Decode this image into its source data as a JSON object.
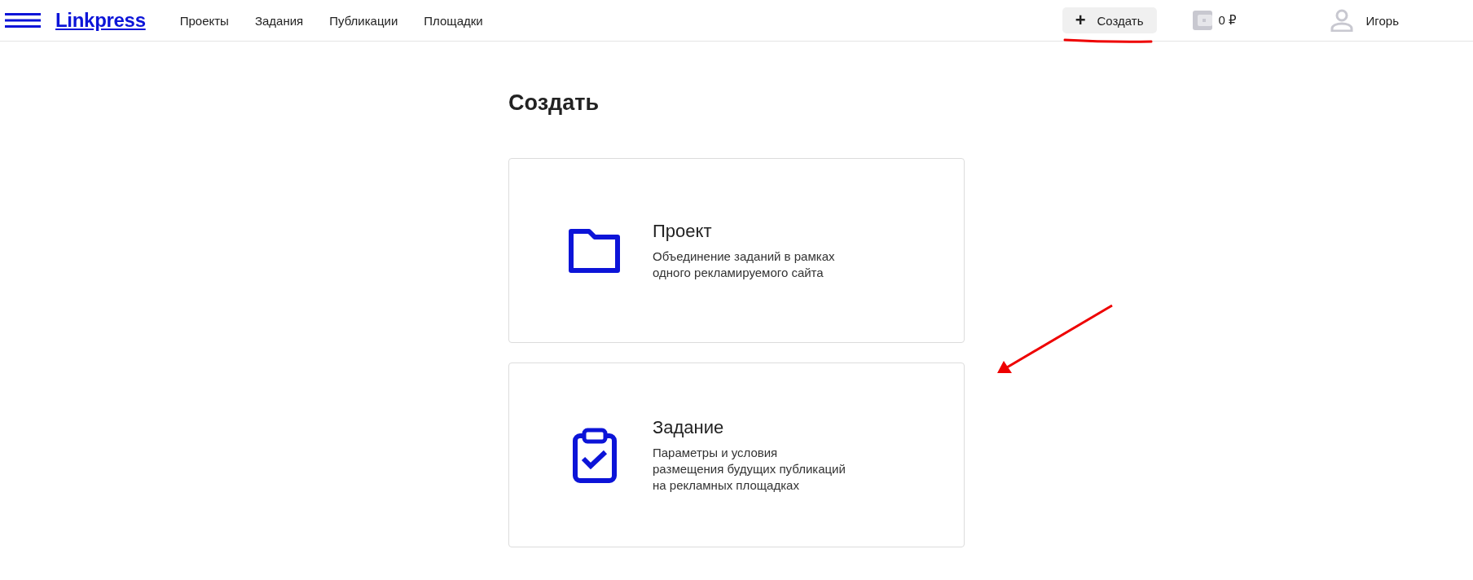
{
  "header": {
    "logo": "Linkpress",
    "nav": [
      {
        "label": "Проекты"
      },
      {
        "label": "Задания"
      },
      {
        "label": "Публикации"
      },
      {
        "label": "Площадки"
      }
    ],
    "create_button": {
      "icon": "+",
      "label": "Создать"
    },
    "balance": "0 ₽",
    "user": "Игорь"
  },
  "page": {
    "title": "Создать",
    "cards": [
      {
        "kind": "folder",
        "title": "Проект",
        "description": "Объединение заданий в рамках\nодного рекламируемого сайта"
      },
      {
        "kind": "clipboard",
        "title": "Задание",
        "description": "Параметры и условия\nразмещения будущих публикаций\nна рекламных площадках"
      }
    ]
  }
}
